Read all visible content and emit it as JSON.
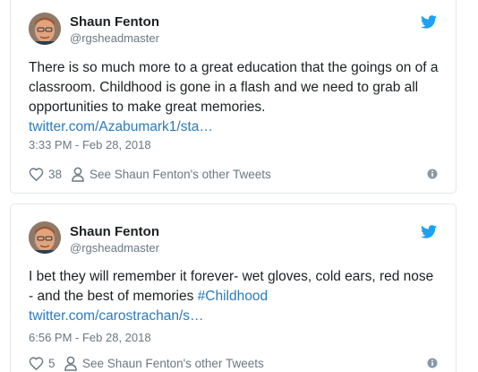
{
  "tweets": [
    {
      "name": "Shaun Fenton",
      "handle": "@rgsheadmaster",
      "text": "There is so much more to a great education that the goings on of a classroom. Childhood is gone in a flash and we need to grab all opportunities to make great memories. ",
      "link": "twitter.com/Azabumark1/sta…",
      "timestamp": "3:33 PM - Feb 28, 2018",
      "likes": "38",
      "other_tweets": "See Shaun Fenton's other Tweets"
    },
    {
      "name": "Shaun Fenton",
      "handle": "@rgsheadmaster",
      "text": "I bet they will remember it forever- wet gloves, cold ears, red nose - and the best of memories ",
      "hashtag": "#Childhood",
      "link": "twitter.com/carostrachan/s…",
      "timestamp": "6:56 PM - Feb 28, 2018",
      "likes": "5",
      "other_tweets": "See Shaun Fenton's other Tweets"
    }
  ],
  "colors": {
    "link": "#2b7bb9",
    "muted": "#697882",
    "twitter_blue": "#1da1f2",
    "border": "#e1e8ed"
  },
  "icons": [
    "twitter-bird-icon",
    "heart-icon",
    "person-icon",
    "info-icon"
  ]
}
